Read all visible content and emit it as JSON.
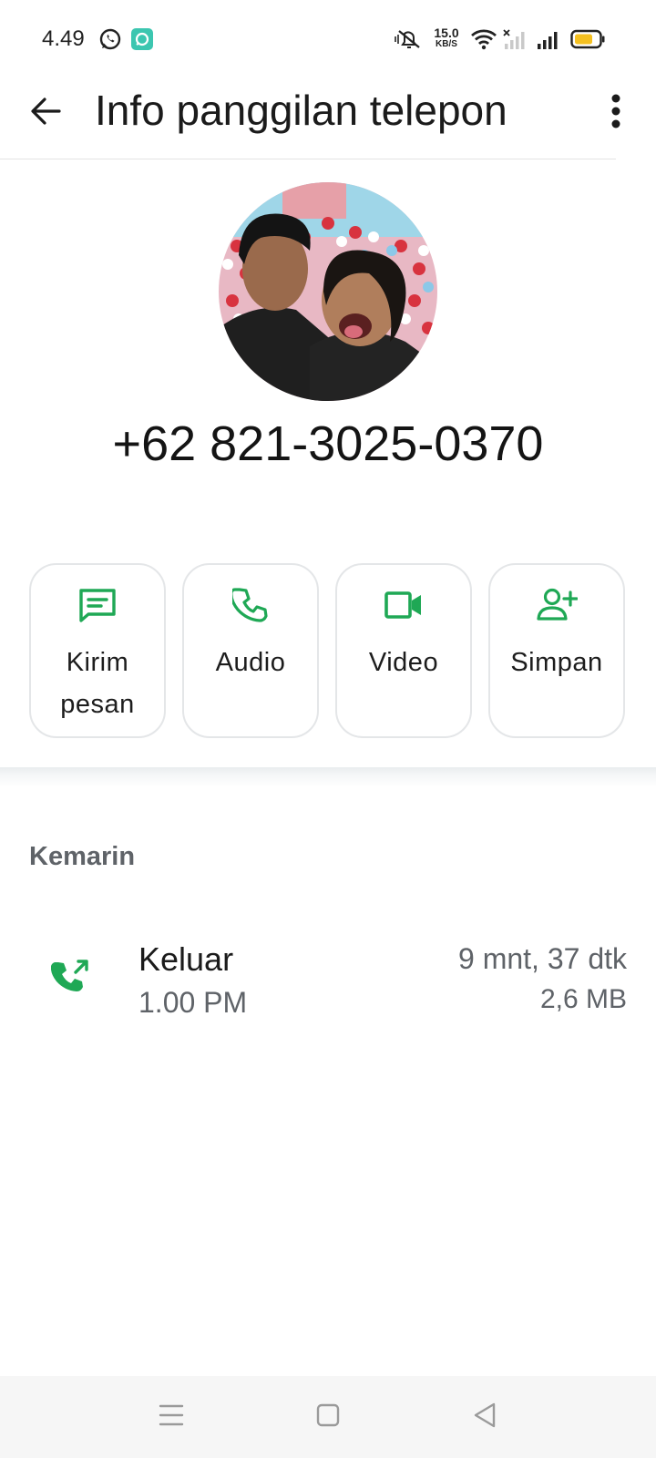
{
  "status_bar": {
    "time": "4.49",
    "net_speed_value": "15.0",
    "net_speed_unit": "KB/S",
    "icons": [
      "whatsapp-icon",
      "app-notification-icon",
      "mute-icon",
      "wifi-icon",
      "signal-no-service-icon",
      "signal-icon",
      "battery-icon"
    ]
  },
  "app_bar": {
    "title": "Info panggilan telepon",
    "back_icon": "arrow-left-icon",
    "menu_icon": "more-vertical-icon"
  },
  "contact": {
    "phone": "+62 821-3025-0370"
  },
  "actions": [
    {
      "label": "Kirim pesan",
      "icon": "message-icon"
    },
    {
      "label": "Audio",
      "icon": "phone-icon"
    },
    {
      "label": "Video",
      "icon": "video-icon"
    },
    {
      "label": "Simpan",
      "icon": "add-contact-icon"
    }
  ],
  "call_log": {
    "section": "Kemarin",
    "entries": [
      {
        "type": "Keluar",
        "time": "1.00 PM",
        "duration": "9 mnt, 37 dtk",
        "size": "2,6 MB",
        "icon": "outgoing-call-icon"
      }
    ]
  },
  "nav_bar": {
    "icons": [
      "menu-icon",
      "home-icon",
      "back-icon"
    ]
  },
  "colors": {
    "accent": "#1fa855",
    "battery": "#f4c020",
    "text_primary": "#1b1b1b",
    "text_secondary": "#5f6368"
  }
}
